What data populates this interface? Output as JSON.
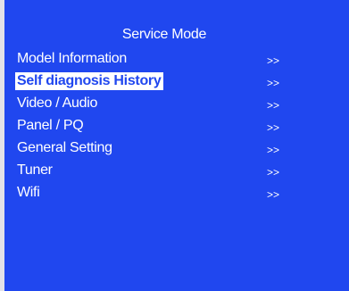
{
  "colors": {
    "background": "#2047ef",
    "text": "#ffffff",
    "selected_background": "#ffffff",
    "selected_text": "#2047ef"
  },
  "title": "Service Mode",
  "menu": {
    "selected_index": 1,
    "items": [
      {
        "label": "Model Information",
        "arrow": ">>"
      },
      {
        "label": "Self diagnosis History",
        "arrow": ">>"
      },
      {
        "label": "Video / Audio",
        "arrow": ">>"
      },
      {
        "label": "Panel / PQ",
        "arrow": ">>"
      },
      {
        "label": "General Setting",
        "arrow": ">>"
      },
      {
        "label": "Tuner",
        "arrow": ">>"
      },
      {
        "label": "Wifi",
        "arrow": ">>"
      }
    ]
  }
}
